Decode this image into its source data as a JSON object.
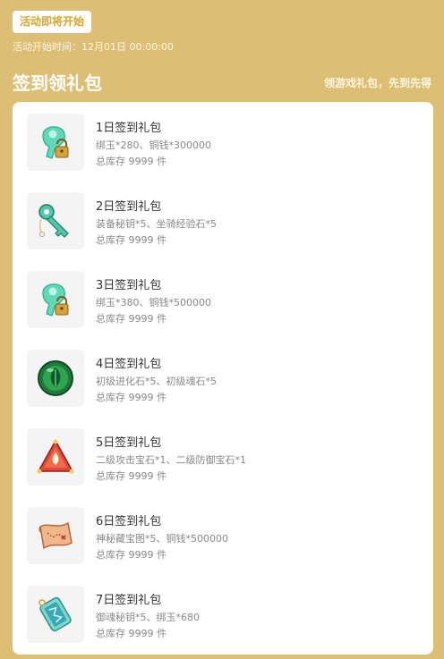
{
  "status_badge": "活动即将开始",
  "start_time": "活动开始时间：12月01日 00:00:00",
  "section": {
    "title": "签到领礼包",
    "slogan": "领游戏礼包，先到先得"
  },
  "gifts": [
    {
      "icon": "jade-lock-icon",
      "name": "1日签到礼包",
      "content": "绑玉*280、铜钱*300000",
      "stock": "总库存 9999 件"
    },
    {
      "icon": "key-icon",
      "name": "2日签到礼包",
      "content": "装备秘钥*5、坐骑经验石*5",
      "stock": "总库存 9999 件"
    },
    {
      "icon": "jade-lock-icon",
      "name": "3日签到礼包",
      "content": "绑玉*380、铜钱*500000",
      "stock": "总库存 9999 件"
    },
    {
      "icon": "evolution-stone-icon",
      "name": "4日签到礼包",
      "content": "初级进化石*5、初级魂石*5",
      "stock": "总库存 9999 件"
    },
    {
      "icon": "gem-icon",
      "name": "5日签到礼包",
      "content": "二级攻击宝石*1、二级防御宝石*1",
      "stock": "总库存 9999 件"
    },
    {
      "icon": "treasure-map-icon",
      "name": "6日签到礼包",
      "content": "神秘藏宝图*5、铜钱*500000",
      "stock": "总库存 9999 件"
    },
    {
      "icon": "soul-key-icon",
      "name": "7日签到礼包",
      "content": "御魂秘钥*5、绑玉*680",
      "stock": "总库存 9999 件"
    }
  ]
}
